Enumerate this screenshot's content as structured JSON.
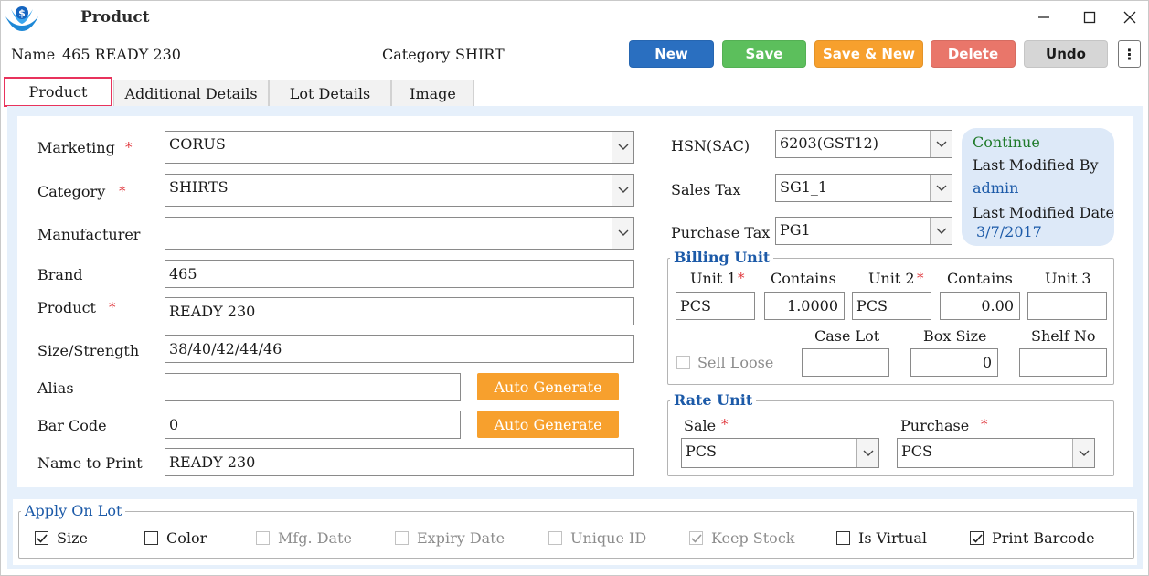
{
  "window": {
    "title": "Product"
  },
  "header": {
    "name_label": "Name",
    "name_value": "465 READY 230",
    "category_label": "Category",
    "category_value": "SHIRT"
  },
  "toolbar": {
    "new_label": "New",
    "save_label": "Save",
    "save_new_label": "Save & New",
    "delete_label": "Delete",
    "undo_label": "Undo",
    "more_label": "⋮",
    "colors": {
      "new": "#2a6fc0",
      "save": "#5cbf5c",
      "save_new": "#f7a02d",
      "delete": "#e9766a",
      "undo": "#d6d6d6"
    }
  },
  "tabs": [
    {
      "label": "Product",
      "active": true
    },
    {
      "label": "Additional Details",
      "active": false
    },
    {
      "label": "Lot Details",
      "active": false
    },
    {
      "label": "Image",
      "active": false
    }
  ],
  "form": {
    "marketing": {
      "label": "Marketing",
      "required": "*",
      "value": "CORUS"
    },
    "category": {
      "label": "Category",
      "required": "*",
      "value": "SHIRTS"
    },
    "manufacturer": {
      "label": "Manufacturer",
      "value": ""
    },
    "brand": {
      "label": "Brand",
      "value": "465"
    },
    "product": {
      "label": "Product",
      "required": "*",
      "value": "READY 230"
    },
    "size": {
      "label": "Size/Strength",
      "value": "38/40/42/44/46"
    },
    "alias": {
      "label": "Alias",
      "value": "",
      "button": "Auto Generate"
    },
    "barcode": {
      "label": "Bar Code",
      "value": "0",
      "button": "Auto Generate"
    },
    "name_to_print": {
      "label": "Name to Print",
      "value": "READY 230"
    }
  },
  "tax": {
    "hsn": {
      "label": "HSN(SAC)",
      "value": "6203(GST12)"
    },
    "sales": {
      "label": "Sales Tax",
      "value": "SG1_1"
    },
    "purchase": {
      "label": "Purchase Tax",
      "value": "PG1"
    }
  },
  "info": {
    "continue": "Continue",
    "modified_by_label": "Last Modified By",
    "modified_by": "admin",
    "modified_date_label": "Last Modified Date",
    "modified_date": "3/7/2017"
  },
  "billing": {
    "title": "Billing Unit",
    "unit1_label": "Unit 1",
    "unit1_req": "*",
    "contains1_label": "Contains",
    "unit2_label": "Unit 2",
    "unit2_req": "*",
    "contains2_label": "Contains",
    "unit3_label": "Unit 3",
    "unit1": "PCS",
    "contains1": "1.0000",
    "unit2": "PCS",
    "contains2": "0.00",
    "unit3": "",
    "sell_loose_label": "Sell Loose",
    "case_lot_label": "Case Lot",
    "box_size_label": "Box Size",
    "shelf_no_label": "Shelf No",
    "case_lot": "",
    "box_size": "0",
    "shelf_no": ""
  },
  "rate": {
    "title": "Rate Unit",
    "sale_label": "Sale",
    "sale_req": "*",
    "purchase_label": "Purchase",
    "purchase_req": "*",
    "sale": "PCS",
    "purchase": "PCS"
  },
  "apply_on_lot": {
    "title": "Apply On Lot",
    "items": [
      {
        "label": "Size",
        "checked": true,
        "enabled": true
      },
      {
        "label": "Color",
        "checked": false,
        "enabled": true
      },
      {
        "label": "Mfg. Date",
        "checked": false,
        "enabled": false
      },
      {
        "label": "Expiry Date",
        "checked": false,
        "enabled": false
      },
      {
        "label": "Unique ID",
        "checked": false,
        "enabled": false
      },
      {
        "label": "Keep Stock",
        "checked": true,
        "enabled": false
      },
      {
        "label": "Is Virtual",
        "checked": false,
        "enabled": true
      },
      {
        "label": "Print Barcode",
        "checked": true,
        "enabled": true
      }
    ]
  }
}
